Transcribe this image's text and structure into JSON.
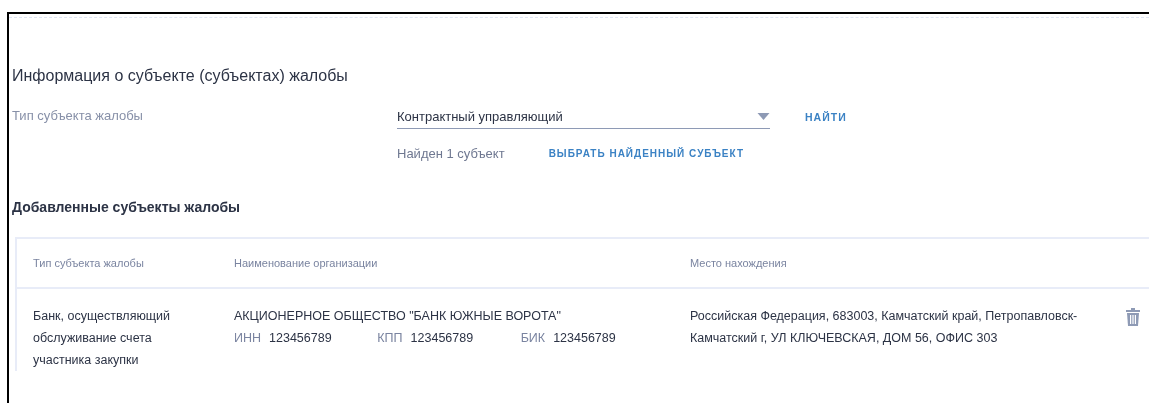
{
  "title": "Информация о субъекте (субъектах) жалобы",
  "subject_type": {
    "label": "Тип субъекта жалобы",
    "value": "Контрактный управляющий",
    "search_button": "НАЙТИ"
  },
  "found": {
    "text": "Найден 1 субъект",
    "select_button": "ВЫБРАТЬ НАЙДЕННЫЙ СУБЪЕКТ"
  },
  "added_title": "Добавленные субъекты жалобы",
  "table": {
    "columns": [
      "Тип субъекта жалобы",
      "Наименование организации",
      "Место нахождения"
    ],
    "rows": [
      {
        "type": "Банк, осуществляющий обслуживание счета участника закупки",
        "name": "АКЦИОНЕРНОЕ ОБЩЕСТВО \"БАНК ЮЖНЫЕ ВОРОТА\"",
        "codes": [
          {
            "label": "ИНН",
            "value": "123456789"
          },
          {
            "label": "КПП",
            "value": "123456789"
          },
          {
            "label": "БИК",
            "value": "123456789"
          }
        ],
        "address": "Российская Федерация, 683003, Камчатский край, Петропавловск-Камчатский г, УЛ КЛЮЧЕВСКАЯ, ДОМ 56, ОФИС 303"
      }
    ]
  }
}
